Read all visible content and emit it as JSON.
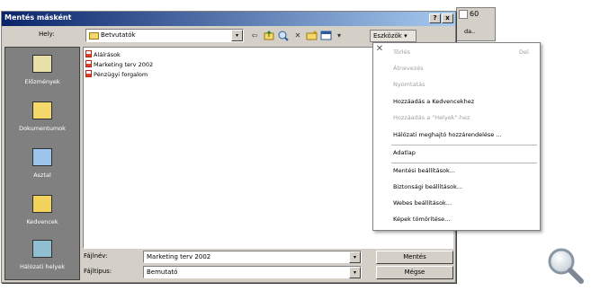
{
  "window": {
    "title": "Mentés másként",
    "help_button": "?",
    "close_button": "x"
  },
  "toolbar": {
    "location_label": "Hely:",
    "location_value": "Betvutatók",
    "dropdown_arrow": "▾",
    "tools_label": "Eszközök ▾"
  },
  "side_strip": {
    "zoom_label": "60",
    "font_label": "da.."
  },
  "places": [
    {
      "label": "Előzmények",
      "icon": "history-icon",
      "color": "#e8e0a8"
    },
    {
      "label": "Dokumentumok",
      "icon": "my-documents-icon",
      "color": "#f5d86a"
    },
    {
      "label": "Asztal",
      "icon": "desktop-icon",
      "color": "#9cc4ec"
    },
    {
      "label": "Kedvencek",
      "icon": "favorites-icon",
      "color": "#f2d45c"
    },
    {
      "label": "Hálózati helyek",
      "icon": "network-places-icon",
      "color": "#8fbfd0"
    }
  ],
  "files": [
    {
      "name": "Aláírások",
      "icon": "powerpoint-file-icon"
    },
    {
      "name": "Marketing terv 2002",
      "icon": "powerpoint-file-icon"
    },
    {
      "name": "Pénzügyi forgalom",
      "icon": "powerpoint-file-icon"
    }
  ],
  "bottom": {
    "filename_label": "Fájlnév:",
    "filename_value": "Marketing terv 2002",
    "filetype_label": "Fájltípus:",
    "filetype_value": "Bemutató",
    "save_button": "Mentés",
    "cancel_button": "Mégse"
  },
  "menu": {
    "close_glyph": "✕",
    "items": [
      {
        "label": "Törlés",
        "shortcut": "Del",
        "disabled": true
      },
      {
        "label": "Átnevezés",
        "shortcut": "",
        "disabled": true
      },
      {
        "label": "Nyomtatás",
        "shortcut": "",
        "disabled": true
      },
      {
        "label": "Hozzáadás a Kedvencekhez",
        "shortcut": "",
        "disabled": false
      },
      {
        "label": "Hozzáadás a \"Helyek\"-hez",
        "shortcut": "",
        "disabled": true
      },
      {
        "label": "Hálózati meghajtó hozzárendelése ...",
        "shortcut": "",
        "disabled": false
      },
      {
        "label": "Adatlap",
        "shortcut": "",
        "disabled": false
      },
      {
        "label": "Mentési beállítások...",
        "shortcut": "",
        "disabled": false
      },
      {
        "label": "Biztonsági beállítások...",
        "shortcut": "",
        "disabled": false
      },
      {
        "label": "Webes beállítások...",
        "shortcut": "",
        "disabled": false
      },
      {
        "label": "Képek tömörítése...",
        "shortcut": "",
        "disabled": false
      }
    ]
  },
  "colors": {
    "title_gradient_start": "#0a246a",
    "title_gradient_end": "#a6caf0",
    "dialog_face": "#d4d0c8",
    "places_bar": "#808080"
  }
}
